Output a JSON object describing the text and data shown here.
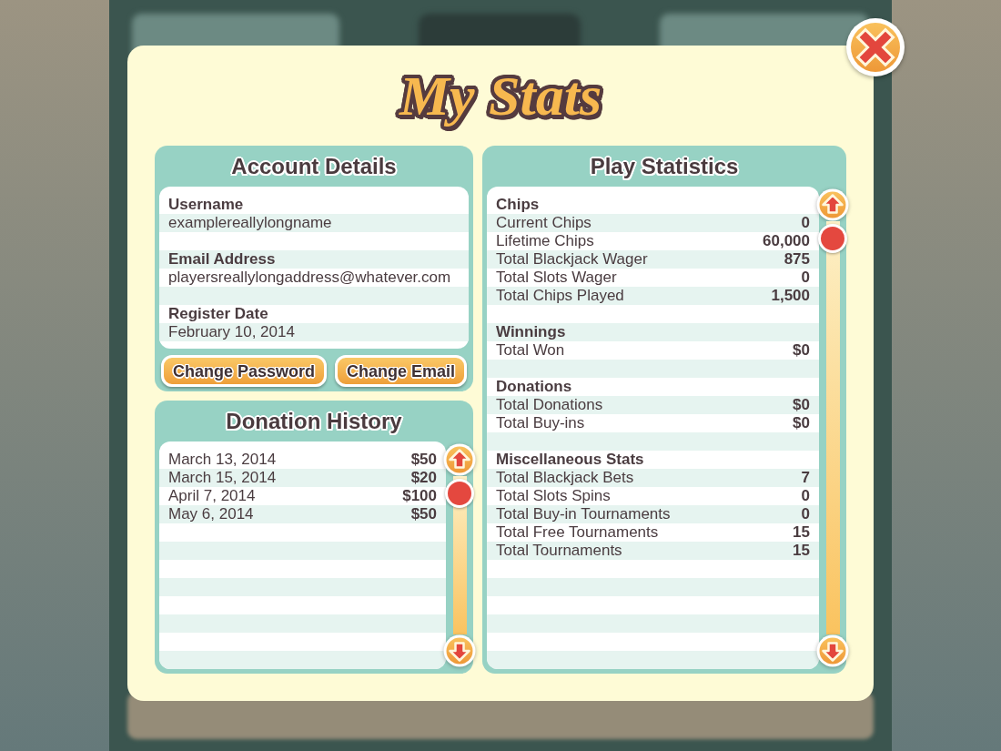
{
  "title": "My Stats",
  "account_details": {
    "title": "Account Details",
    "fields": [
      {
        "label": "Username",
        "value": "examplereallylongname"
      },
      {
        "label": "Email Address",
        "value": "playersreallylongaddress@whatever.com"
      },
      {
        "label": "Register Date",
        "value": "February 10, 2014"
      }
    ],
    "buttons": [
      "Change Password",
      "Change Email"
    ]
  },
  "donation_history": {
    "title": "Donation History",
    "rows": [
      {
        "date": "March 13, 2014",
        "amount": "$50"
      },
      {
        "date": "March 15, 2014",
        "amount": "$20"
      },
      {
        "date": "April 7, 2014",
        "amount": "$100"
      },
      {
        "date": "May 6, 2014",
        "amount": "$50"
      }
    ]
  },
  "play_statistics": {
    "title": "Play Statistics",
    "sections": [
      {
        "title": "Chips",
        "rows": [
          {
            "label": "Current Chips",
            "value": "0"
          },
          {
            "label": "Lifetime Chips",
            "value": "60,000"
          },
          {
            "label": "Total Blackjack Wager",
            "value": "875"
          },
          {
            "label": "Total Slots Wager",
            "value": "0"
          },
          {
            "label": "Total Chips Played",
            "value": "1,500"
          }
        ]
      },
      {
        "title": "Winnings",
        "rows": [
          {
            "label": "Total Won",
            "value": "$0"
          }
        ]
      },
      {
        "title": "Donations",
        "rows": [
          {
            "label": "Total Donations",
            "value": "$0"
          },
          {
            "label": "Total Buy-ins",
            "value": "$0"
          }
        ]
      },
      {
        "title": "Miscellaneous Stats",
        "rows": [
          {
            "label": "Total Blackjack Bets",
            "value": "7"
          },
          {
            "label": "Total Slots Spins",
            "value": "0"
          },
          {
            "label": "Total Buy-in Tournaments",
            "value": "0"
          },
          {
            "label": "Total Free Tournaments",
            "value": "15"
          },
          {
            "label": "Total Tournaments",
            "value": "15"
          }
        ]
      }
    ]
  }
}
